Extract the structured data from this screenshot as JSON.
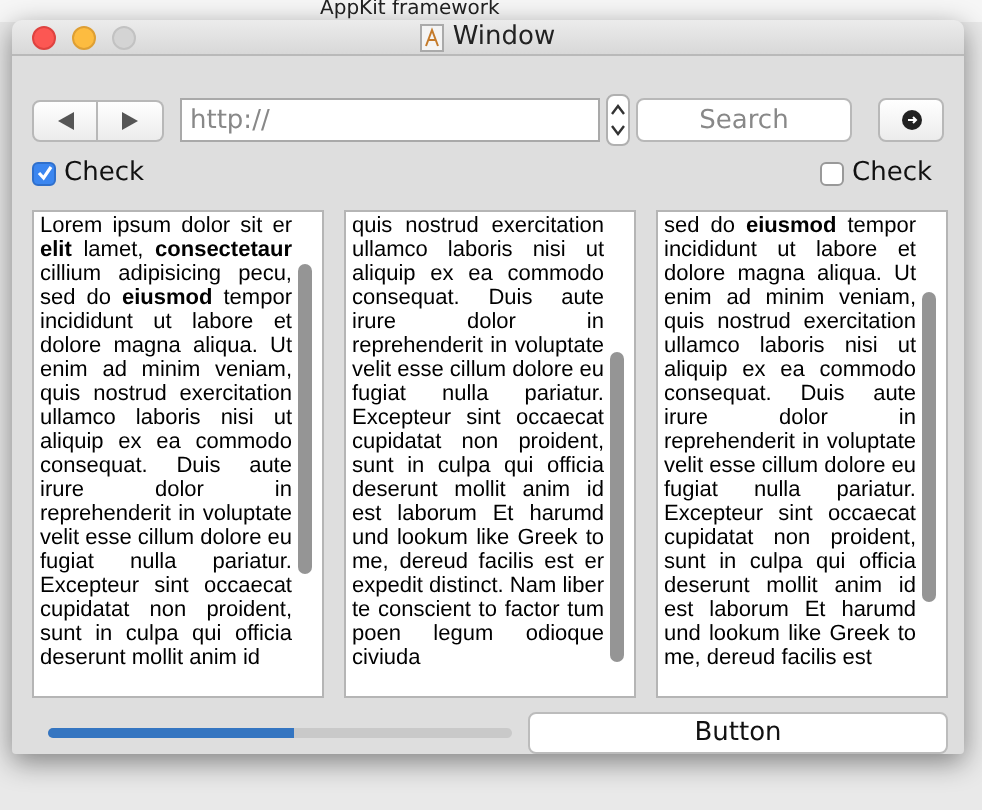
{
  "background": {
    "title": "AppKit framework"
  },
  "window": {
    "title": "Window"
  },
  "toolbar": {
    "address": {
      "placeholder": "http://"
    },
    "search": {
      "placeholder": "Search"
    }
  },
  "checks": [
    {
      "label": "Check",
      "checked": true
    },
    {
      "label": "Check",
      "checked": false
    }
  ],
  "text_columns": [
    {
      "text": "Lorem ipsum dolor sit er **elit** lamet, **consectetaur** cillium adipisicing pecu, sed do **eiusmod** tempor incididunt ut labore et dolore magna aliqua. Ut enim ad minim veniam, quis nostrud exercitation ullamco laboris nisi ut aliquip ex ea commodo consequat. Duis aute irure dolor in reprehenderit in voluptate velit esse cillum dolore eu fugiat nulla pariatur. Excepteur sint occaecat cupidatat non proident, sunt in culpa qui officia deserunt mollit anim id"
    },
    {
      "text": "quis nostrud exercitation ullamco laboris nisi ut aliquip ex ea commodo consequat. Duis aute irure dolor in reprehenderit in voluptate velit esse cillum dolore eu fugiat nulla pariatur. Excepteur sint occaecat cupidatat non proident, sunt in culpa qui officia deserunt mollit anim id est laborum Et harumd und lookum like Greek to me, dereud facilis est er expedit distinct. Nam liber te conscient to factor tum poen legum odioque civiuda"
    },
    {
      "text": "sed do **eiusmod** tempor incididunt ut labore et dolore magna aliqua. Ut enim ad minim veniam, quis nostrud exercitation ullamco laboris nisi ut aliquip ex ea commodo consequat. Duis aute irure dolor in reprehenderit in voluptate velit esse cillum dolore eu fugiat nulla pariatur. Excepteur sint occaecat cupidatat non proident, sunt in culpa qui officia deserunt mollit anim id est laborum Et harumd und lookum like Greek to me, dereud facilis est"
    }
  ],
  "progress": {
    "level": 0.53
  },
  "button": {
    "label": "Button"
  }
}
